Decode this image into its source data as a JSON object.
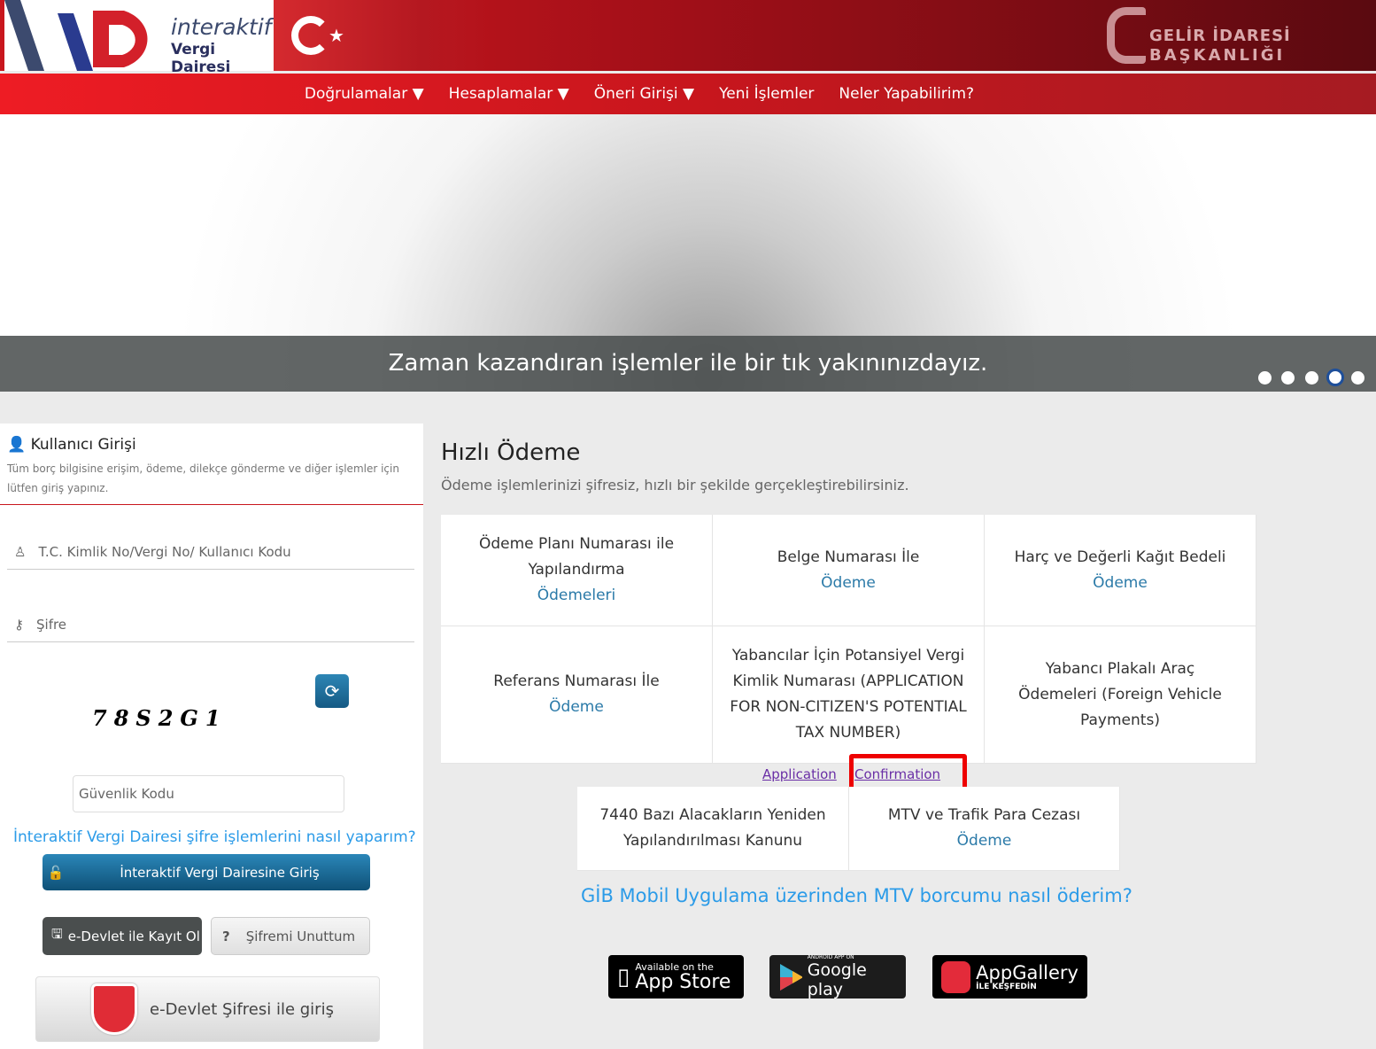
{
  "header": {
    "logo_line1": "interaktif",
    "logo_line2": "Vergi Dairesi",
    "gib_line1": "GELİR İDARESİ",
    "gib_line2": "BAŞKANLIĞI"
  },
  "nav": [
    {
      "label": "Doğrulamalar ▼"
    },
    {
      "label": "Hesaplamalar ▼"
    },
    {
      "label": "Öneri Girişi ▼"
    },
    {
      "label": "Yeni İşlemler"
    },
    {
      "label": "Neler Yapabilirim?"
    }
  ],
  "hero": {
    "caption": "Zaman kazandıran işlemler ile bir tık yakınınızdayız.",
    "slides": 5,
    "active_slide": 4
  },
  "login": {
    "title": "Kullanıcı Girişi",
    "desc": "Tüm borç bilgisine erişim, ödeme, dilekçe gönderme ve diğer işlemler için lütfen giriş yapınız.",
    "user_placeholder": "T.C. Kimlik No/Vergi No/ Kullanıcı Kodu",
    "password_placeholder": "Şifre",
    "captcha": "78S2G1",
    "security_placeholder": "Güvenlik Kodu",
    "help_link": "İnteraktif Vergi Dairesi şifre işlemlerini nasıl yaparım?",
    "login_button": "İnteraktif Vergi Dairesine Giriş",
    "register_button": "e-Devlet ile Kayıt Ol",
    "forgot_button": "Şifremi Unuttum",
    "edevlet_button": "e-Devlet Şifresi ile giriş"
  },
  "quick": {
    "title": "Hızlı Ödeme",
    "subtitle": "Ödeme işlemlerinizi şifresiz, hızlı bir şekilde gerçekleştirebilirsiniz.",
    "cards": [
      {
        "text": "Ödeme Planı Numarası ile Yapılandırma",
        "link": "Ödemeleri"
      },
      {
        "text": "Belge Numarası İle",
        "link": "Ödeme"
      },
      {
        "text": "Harç ve Değerli Kağıt Bedeli",
        "link": "Ödeme"
      },
      {
        "text": "Referans Numarası İle",
        "link": "Ödeme"
      },
      {
        "text": "Yabancılar İçin Potansiyel Vergi Kimlik Numarası (APPLICATION FOR NON-CITIZEN'S POTENTIAL TAX NUMBER)",
        "link": ""
      },
      {
        "text": "Yabancı Plakalı Araç Ödemeleri (Foreign Vehicle Payments)",
        "link": ""
      },
      {
        "text": "7440 Bazı Alacakların Yeniden Yapılandırılması Kanunu",
        "link": ""
      },
      {
        "text": "MTV ve Trafik Para Cezası",
        "link": "Ödeme"
      }
    ],
    "application_link": "Application",
    "confirmation_link": "Confirmation",
    "mobile_link": "GİB Mobil Uygulama üzerinden MTV borcumu nasıl öderim?"
  },
  "apps": {
    "appstore_small": "Available on the",
    "appstore_big": "App Store",
    "google_small": "ANDROID APP ON",
    "google_big": "Google play",
    "huawei_big": "AppGallery",
    "huawei_small": "İLE KEŞFEDİN"
  }
}
